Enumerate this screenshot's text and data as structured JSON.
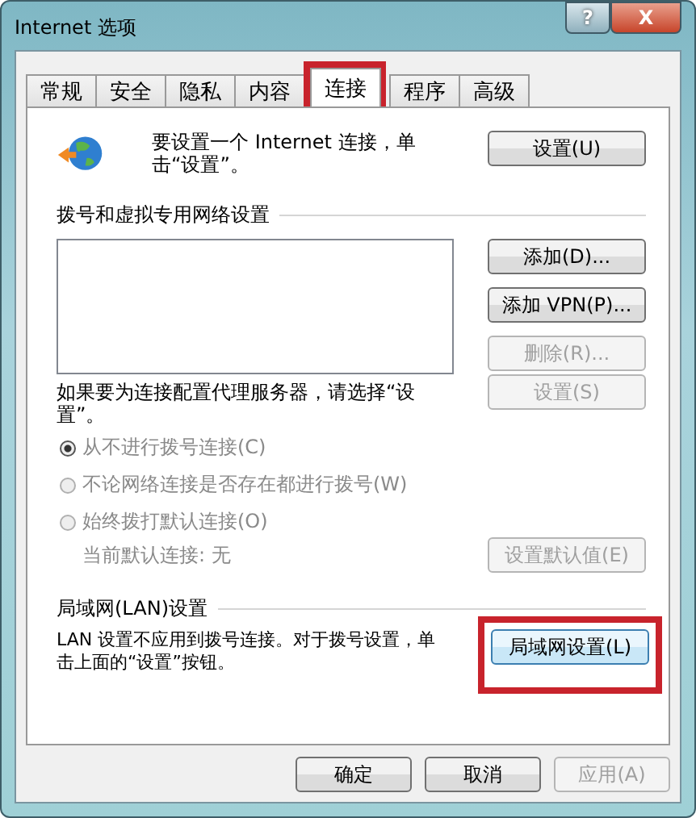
{
  "window": {
    "title": "Internet 选项",
    "help_button": "?",
    "close_button": "X"
  },
  "tabs": [
    {
      "label": "常规",
      "selected": false,
      "highlighted": false
    },
    {
      "label": "安全",
      "selected": false,
      "highlighted": false
    },
    {
      "label": "隐私",
      "selected": false,
      "highlighted": false
    },
    {
      "label": "内容",
      "selected": false,
      "highlighted": false
    },
    {
      "label": "连接",
      "selected": true,
      "highlighted": true
    },
    {
      "label": "程序",
      "selected": false,
      "highlighted": false
    },
    {
      "label": "高级",
      "selected": false,
      "highlighted": false
    }
  ],
  "setup": {
    "text": "要设置一个 Internet 连接，单击“设置”。",
    "button": {
      "label": "设置(U)",
      "disabled": false
    }
  },
  "dialup": {
    "title": "拨号和虚拟专用网络设置",
    "buttons": [
      {
        "label": "添加(D)...",
        "disabled": false
      },
      {
        "label": "添加 VPN(P)...",
        "disabled": false
      },
      {
        "label": "删除(R)...",
        "disabled": true
      }
    ],
    "proxy_text": "如果要为连接配置代理服务器，请选择“设置”。",
    "proxy_button": {
      "label": "设置(S)",
      "disabled": true
    },
    "radios": [
      {
        "label": "从不进行拨号连接(C)",
        "selected": true,
        "disabled": true
      },
      {
        "label": "不论网络连接是否存在都进行拨号(W)",
        "selected": false,
        "disabled": true
      },
      {
        "label": "始终拨打默认连接(O)",
        "selected": false,
        "disabled": true
      }
    ],
    "default_text": "当前默认连接: 无",
    "default_button": {
      "label": "设置默认值(E)",
      "disabled": true
    }
  },
  "lan": {
    "title": "局域网(LAN)设置",
    "text": "LAN 设置不应用到拨号连接。对于拨号设置，单击上面的“设置”按钮。",
    "button": {
      "label": "局域网设置(L)",
      "disabled": false,
      "highlighted": true
    }
  },
  "footer": [
    {
      "label": "确定",
      "disabled": false
    },
    {
      "label": "取消",
      "disabled": false
    },
    {
      "label": "应用(A)",
      "disabled": true
    }
  ]
}
